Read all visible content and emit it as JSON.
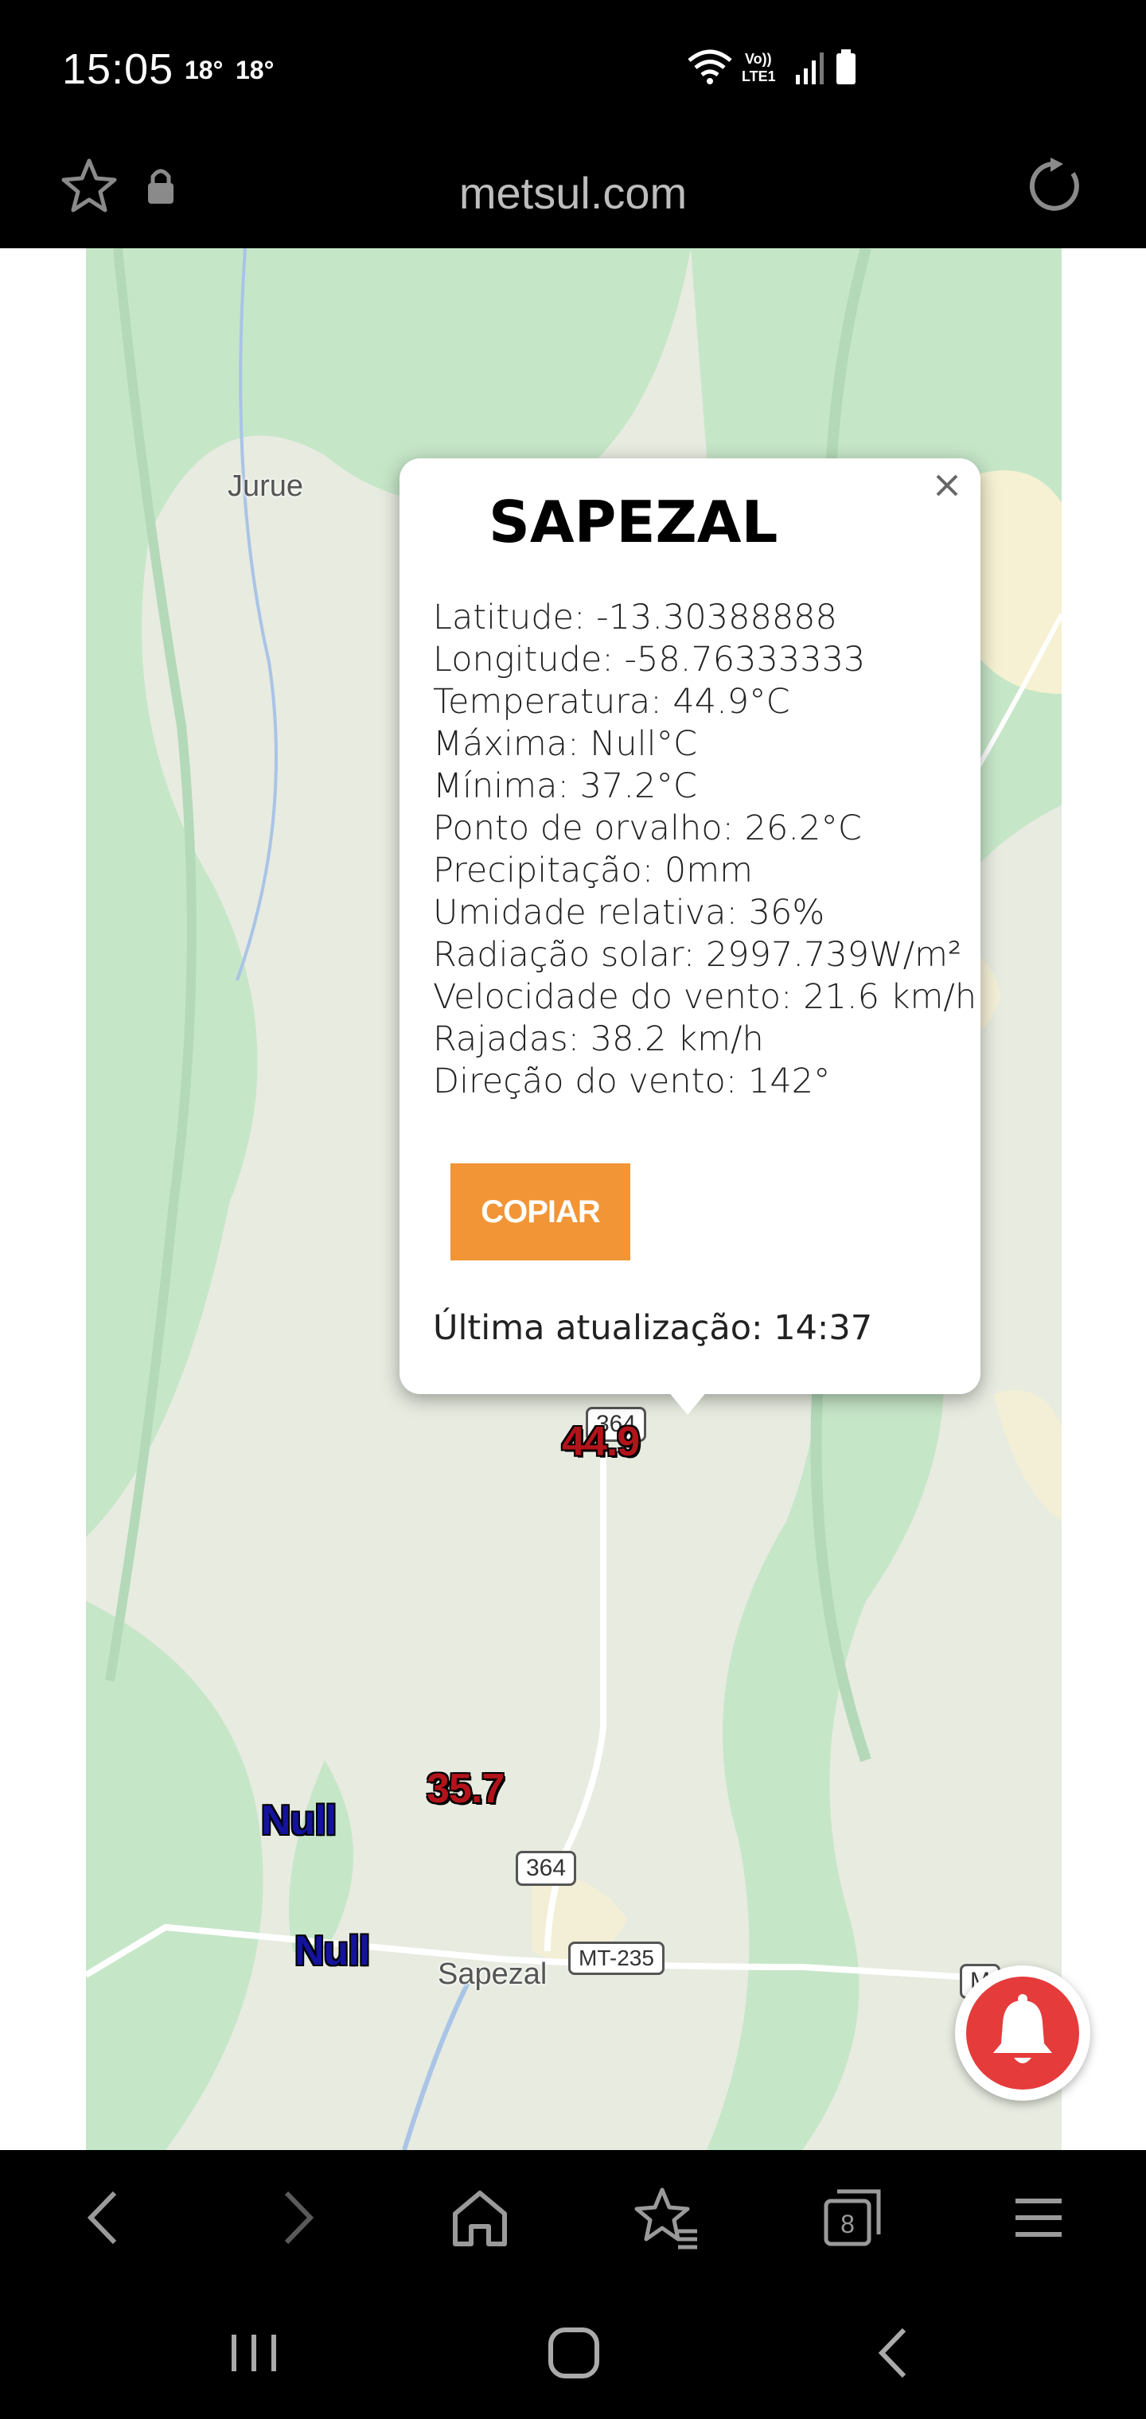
{
  "status_bar": {
    "time": "15:05",
    "temp1": "18°",
    "temp2": "18°",
    "network_label": "Vo))\nLTE1"
  },
  "browser": {
    "url": "metsul.com",
    "icons": [
      "bookmark-star-icon",
      "lock-icon",
      "reload-icon"
    ]
  },
  "map": {
    "labels": {
      "place_juruena": "Jurue",
      "place_sapezal": "Sapezal",
      "road_364_top": "364",
      "road_364": "364",
      "road_mt235": "MT-235",
      "road_mt_partial": "M"
    },
    "markers": {
      "m1": "44.9",
      "m2": "35.7",
      "m3": "Null",
      "m4": "Null"
    }
  },
  "popup": {
    "title": "SAPEZAL",
    "rows": [
      "Latitude: -13.30388888",
      "Longitude: -58.76333333",
      "Temperatura: 44.9°C",
      "Máxima: Null°C",
      "Mínima: 37.2°C",
      "Ponto de orvalho: 26.2°C",
      "Precipitação: 0mm",
      "Umidade relativa: 36%",
      "Radiação solar: 2997.739W/m²",
      "Velocidade do vento: 21.6 km/h",
      "Rajadas: 38.2 km/h",
      "Direção do vento: 142°"
    ],
    "copy_label": "COPIAR",
    "updated": "Última atualização: 14:37"
  },
  "colors": {
    "accent_orange": "#f29536",
    "marker_red": "#b3141b",
    "marker_blue": "#13139c",
    "notification_red": "#e53b3b",
    "map_forest": "#c6e6c8",
    "map_land": "#e7ebe0"
  }
}
